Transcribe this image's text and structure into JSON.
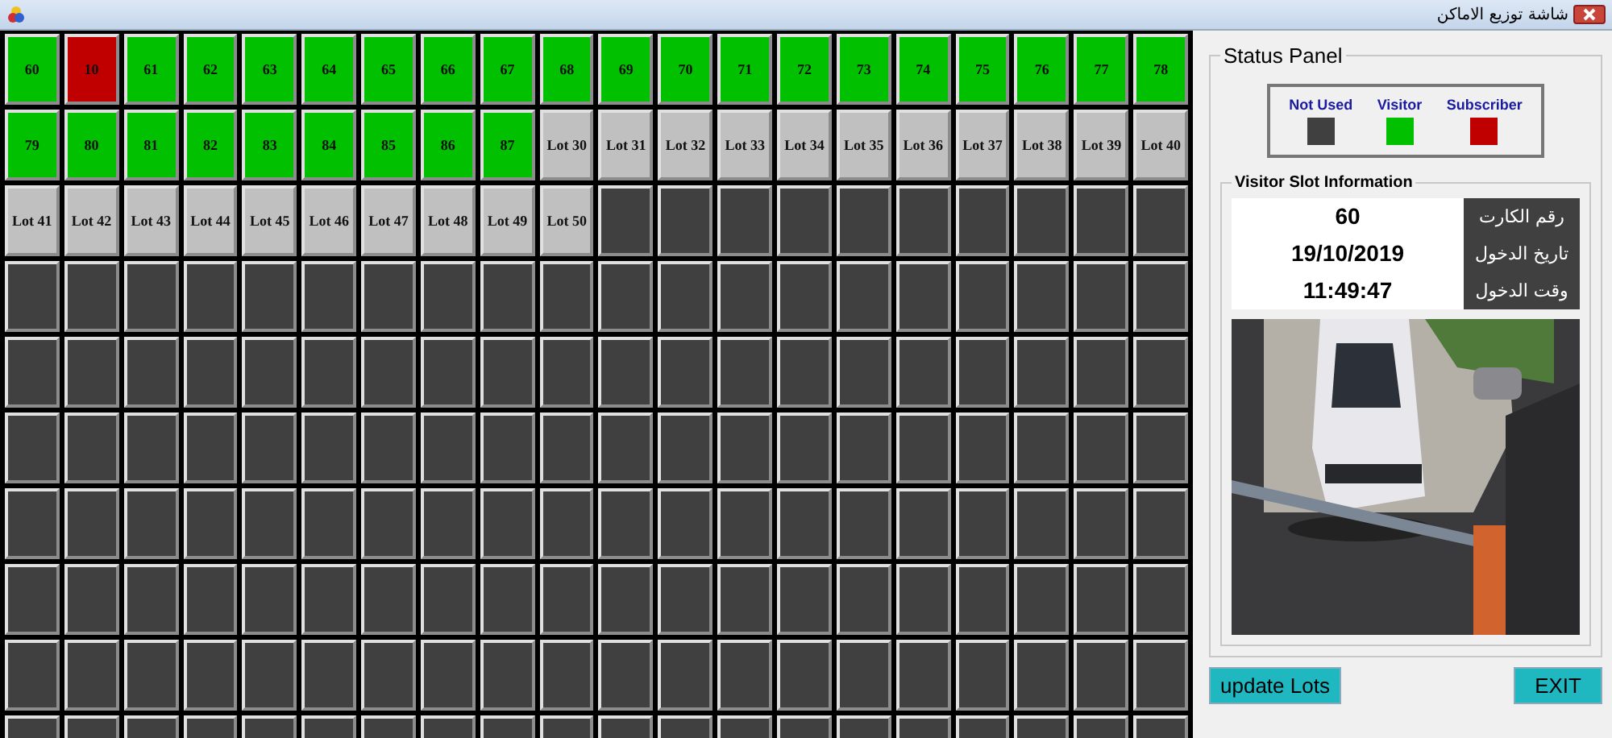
{
  "window": {
    "title": "شاشة توزيع الاماكن"
  },
  "grid": {
    "rows": [
      [
        {
          "kind": "visitor",
          "label": "60"
        },
        {
          "kind": "subscriber",
          "label": "10"
        },
        {
          "kind": "visitor",
          "label": "61"
        },
        {
          "kind": "visitor",
          "label": "62"
        },
        {
          "kind": "visitor",
          "label": "63"
        },
        {
          "kind": "visitor",
          "label": "64"
        },
        {
          "kind": "visitor",
          "label": "65"
        },
        {
          "kind": "visitor",
          "label": "66"
        },
        {
          "kind": "visitor",
          "label": "67"
        },
        {
          "kind": "visitor",
          "label": "68"
        },
        {
          "kind": "visitor",
          "label": "69"
        },
        {
          "kind": "visitor",
          "label": "70"
        },
        {
          "kind": "visitor",
          "label": "71"
        },
        {
          "kind": "visitor",
          "label": "72"
        },
        {
          "kind": "visitor",
          "label": "73"
        },
        {
          "kind": "visitor",
          "label": "74"
        },
        {
          "kind": "visitor",
          "label": "75"
        },
        {
          "kind": "visitor",
          "label": "76"
        },
        {
          "kind": "visitor",
          "label": "77"
        },
        {
          "kind": "visitor",
          "label": "78"
        }
      ],
      [
        {
          "kind": "visitor",
          "label": "79"
        },
        {
          "kind": "visitor",
          "label": "80"
        },
        {
          "kind": "visitor",
          "label": "81"
        },
        {
          "kind": "visitor",
          "label": "82"
        },
        {
          "kind": "visitor",
          "label": "83"
        },
        {
          "kind": "visitor",
          "label": "84"
        },
        {
          "kind": "visitor",
          "label": "85"
        },
        {
          "kind": "visitor",
          "label": "86"
        },
        {
          "kind": "visitor",
          "label": "87"
        },
        {
          "kind": "lot",
          "label": "Lot 30"
        },
        {
          "kind": "lot",
          "label": "Lot 31"
        },
        {
          "kind": "lot",
          "label": "Lot 32"
        },
        {
          "kind": "lot",
          "label": "Lot 33"
        },
        {
          "kind": "lot",
          "label": "Lot 34"
        },
        {
          "kind": "lot",
          "label": "Lot 35"
        },
        {
          "kind": "lot",
          "label": "Lot 36"
        },
        {
          "kind": "lot",
          "label": "Lot 37"
        },
        {
          "kind": "lot",
          "label": "Lot 38"
        },
        {
          "kind": "lot",
          "label": "Lot 39"
        },
        {
          "kind": "lot",
          "label": "Lot 40"
        }
      ],
      [
        {
          "kind": "lot",
          "label": "Lot 41"
        },
        {
          "kind": "lot",
          "label": "Lot 42"
        },
        {
          "kind": "lot",
          "label": "Lot 43"
        },
        {
          "kind": "lot",
          "label": "Lot 44"
        },
        {
          "kind": "lot",
          "label": "Lot 45"
        },
        {
          "kind": "lot",
          "label": "Lot 46"
        },
        {
          "kind": "lot",
          "label": "Lot 47"
        },
        {
          "kind": "lot",
          "label": "Lot 48"
        },
        {
          "kind": "lot",
          "label": "Lot 49"
        },
        {
          "kind": "lot",
          "label": "Lot 50"
        },
        {
          "kind": "empty"
        },
        {
          "kind": "empty"
        },
        {
          "kind": "empty"
        },
        {
          "kind": "empty"
        },
        {
          "kind": "empty"
        },
        {
          "kind": "empty"
        },
        {
          "kind": "empty"
        },
        {
          "kind": "empty"
        },
        {
          "kind": "empty"
        },
        {
          "kind": "empty"
        }
      ],
      [
        {
          "kind": "empty"
        },
        {
          "kind": "empty"
        },
        {
          "kind": "empty"
        },
        {
          "kind": "empty"
        },
        {
          "kind": "empty"
        },
        {
          "kind": "empty"
        },
        {
          "kind": "empty"
        },
        {
          "kind": "empty"
        },
        {
          "kind": "empty"
        },
        {
          "kind": "empty"
        },
        {
          "kind": "empty"
        },
        {
          "kind": "empty"
        },
        {
          "kind": "empty"
        },
        {
          "kind": "empty"
        },
        {
          "kind": "empty"
        },
        {
          "kind": "empty"
        },
        {
          "kind": "empty"
        },
        {
          "kind": "empty"
        },
        {
          "kind": "empty"
        },
        {
          "kind": "empty"
        }
      ],
      [
        {
          "kind": "empty"
        },
        {
          "kind": "empty"
        },
        {
          "kind": "empty"
        },
        {
          "kind": "empty"
        },
        {
          "kind": "empty"
        },
        {
          "kind": "empty"
        },
        {
          "kind": "empty"
        },
        {
          "kind": "empty"
        },
        {
          "kind": "empty"
        },
        {
          "kind": "empty"
        },
        {
          "kind": "empty"
        },
        {
          "kind": "empty"
        },
        {
          "kind": "empty"
        },
        {
          "kind": "empty"
        },
        {
          "kind": "empty"
        },
        {
          "kind": "empty"
        },
        {
          "kind": "empty"
        },
        {
          "kind": "empty"
        },
        {
          "kind": "empty"
        },
        {
          "kind": "empty"
        }
      ],
      [
        {
          "kind": "empty"
        },
        {
          "kind": "empty"
        },
        {
          "kind": "empty"
        },
        {
          "kind": "empty"
        },
        {
          "kind": "empty"
        },
        {
          "kind": "empty"
        },
        {
          "kind": "empty"
        },
        {
          "kind": "empty"
        },
        {
          "kind": "empty"
        },
        {
          "kind": "empty"
        },
        {
          "kind": "empty"
        },
        {
          "kind": "empty"
        },
        {
          "kind": "empty"
        },
        {
          "kind": "empty"
        },
        {
          "kind": "empty"
        },
        {
          "kind": "empty"
        },
        {
          "kind": "empty"
        },
        {
          "kind": "empty"
        },
        {
          "kind": "empty"
        },
        {
          "kind": "empty"
        }
      ],
      [
        {
          "kind": "empty"
        },
        {
          "kind": "empty"
        },
        {
          "kind": "empty"
        },
        {
          "kind": "empty"
        },
        {
          "kind": "empty"
        },
        {
          "kind": "empty"
        },
        {
          "kind": "empty"
        },
        {
          "kind": "empty"
        },
        {
          "kind": "empty"
        },
        {
          "kind": "empty"
        },
        {
          "kind": "empty"
        },
        {
          "kind": "empty"
        },
        {
          "kind": "empty"
        },
        {
          "kind": "empty"
        },
        {
          "kind": "empty"
        },
        {
          "kind": "empty"
        },
        {
          "kind": "empty"
        },
        {
          "kind": "empty"
        },
        {
          "kind": "empty"
        },
        {
          "kind": "empty"
        }
      ],
      [
        {
          "kind": "empty"
        },
        {
          "kind": "empty"
        },
        {
          "kind": "empty"
        },
        {
          "kind": "empty"
        },
        {
          "kind": "empty"
        },
        {
          "kind": "empty"
        },
        {
          "kind": "empty"
        },
        {
          "kind": "empty"
        },
        {
          "kind": "empty"
        },
        {
          "kind": "empty"
        },
        {
          "kind": "empty"
        },
        {
          "kind": "empty"
        },
        {
          "kind": "empty"
        },
        {
          "kind": "empty"
        },
        {
          "kind": "empty"
        },
        {
          "kind": "empty"
        },
        {
          "kind": "empty"
        },
        {
          "kind": "empty"
        },
        {
          "kind": "empty"
        },
        {
          "kind": "empty"
        }
      ],
      [
        {
          "kind": "empty"
        },
        {
          "kind": "empty"
        },
        {
          "kind": "empty"
        },
        {
          "kind": "empty"
        },
        {
          "kind": "empty"
        },
        {
          "kind": "empty"
        },
        {
          "kind": "empty"
        },
        {
          "kind": "empty"
        },
        {
          "kind": "empty"
        },
        {
          "kind": "empty"
        },
        {
          "kind": "empty"
        },
        {
          "kind": "empty"
        },
        {
          "kind": "empty"
        },
        {
          "kind": "empty"
        },
        {
          "kind": "empty"
        },
        {
          "kind": "empty"
        },
        {
          "kind": "empty"
        },
        {
          "kind": "empty"
        },
        {
          "kind": "empty"
        },
        {
          "kind": "empty"
        }
      ],
      [
        {
          "kind": "empty"
        },
        {
          "kind": "empty"
        },
        {
          "kind": "empty"
        },
        {
          "kind": "empty"
        },
        {
          "kind": "empty"
        },
        {
          "kind": "empty"
        },
        {
          "kind": "empty"
        },
        {
          "kind": "empty"
        },
        {
          "kind": "empty"
        },
        {
          "kind": "empty"
        },
        {
          "kind": "empty"
        },
        {
          "kind": "empty"
        },
        {
          "kind": "empty"
        },
        {
          "kind": "empty"
        },
        {
          "kind": "empty"
        },
        {
          "kind": "empty"
        },
        {
          "kind": "empty"
        },
        {
          "kind": "empty"
        },
        {
          "kind": "empty"
        },
        {
          "kind": "empty"
        }
      ]
    ]
  },
  "status_panel": {
    "title": "Status Panel",
    "legend": [
      {
        "label": "Not Used",
        "color": "#404040"
      },
      {
        "label": "Visitor",
        "color": "#00c000"
      },
      {
        "label": "Subscriber",
        "color": "#c00000"
      }
    ],
    "visitor_slot": {
      "title": "Visitor Slot Information",
      "fields": [
        {
          "label": "رقم الكارت",
          "value": "60"
        },
        {
          "label": "تاريخ الدخول",
          "value": "19/10/2019"
        },
        {
          "label": "وقت الدخول",
          "value": "11:49:47"
        }
      ]
    }
  },
  "buttons": [
    {
      "label": "update Lots"
    },
    {
      "label": "EXIT"
    }
  ]
}
